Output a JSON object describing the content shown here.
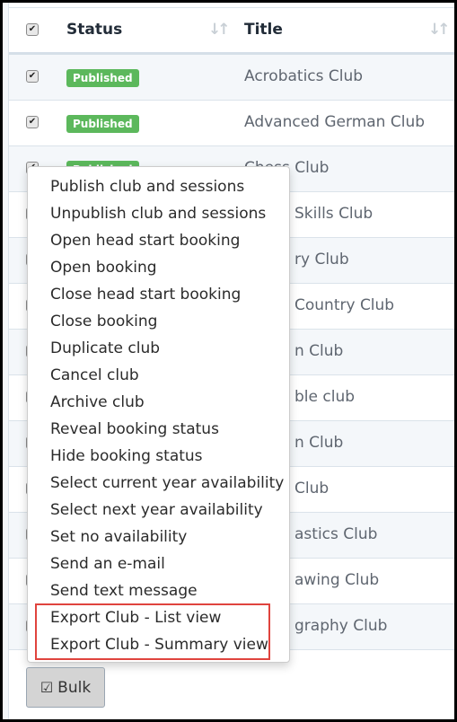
{
  "table": {
    "headers": {
      "status": "Status",
      "title": "Title"
    },
    "rows": [
      {
        "checked": true,
        "status": "Published",
        "title": "Acrobatics Club"
      },
      {
        "checked": true,
        "status": "Published",
        "title": "Advanced German Club"
      },
      {
        "checked": true,
        "status": "Published",
        "title": "Chess Club"
      },
      {
        "checked": false,
        "title": "Skills Club"
      },
      {
        "checked": false,
        "title": "ry Club"
      },
      {
        "checked": false,
        "title": "Country Club"
      },
      {
        "checked": false,
        "title": "n Club"
      },
      {
        "checked": false,
        "title": "ble club"
      },
      {
        "checked": false,
        "title": "n Club"
      },
      {
        "checked": false,
        "title": "Club"
      },
      {
        "checked": false,
        "title": "astics Club"
      },
      {
        "checked": false,
        "title": "awing Club"
      },
      {
        "checked": false,
        "title": "graphy Club"
      }
    ]
  },
  "bulk_menu": {
    "items": [
      "Publish club and sessions",
      "Unpublish club and sessions",
      "Open head start booking",
      "Open booking",
      "Close head start booking",
      "Close booking",
      "Duplicate club",
      "Cancel club",
      "Archive club",
      "Reveal booking status",
      "Hide booking status",
      "Select current year availability",
      "Select next year availability",
      "Set no availability",
      "Send an e-mail",
      "Send text message",
      "Export Club - List view",
      "Export Club - Summary view"
    ],
    "highlight_color": "#e0443e"
  },
  "bulk_button": {
    "label": "Bulk",
    "icon": "check-square-icon"
  },
  "colors": {
    "published_badge": "#5cb85c"
  }
}
